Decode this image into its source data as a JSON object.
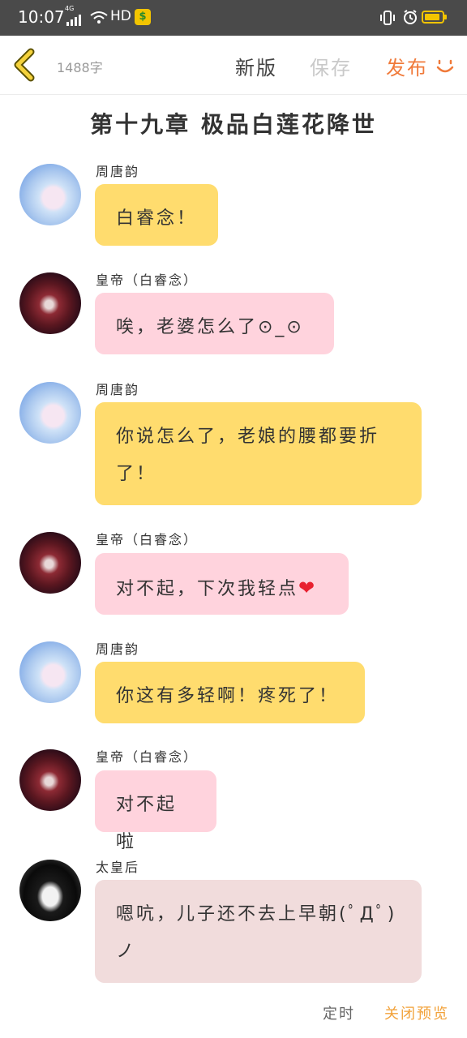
{
  "status_bar": {
    "time": "10:07",
    "network_tag": "4G",
    "hd_label": "HD",
    "app_badge": "$"
  },
  "toolbar": {
    "word_count": "1488字",
    "new_version": "新版",
    "save": "保存",
    "publish": "发布"
  },
  "chapter_title": "第十九章 极品白莲花降世",
  "messages": [
    {
      "speaker": "周唐韵",
      "text": "白睿念！",
      "bubble": "yellow"
    },
    {
      "speaker": "皇帝（白睿念）",
      "text": "唉，老婆怎么了⊙_⊙",
      "bubble": "pink"
    },
    {
      "speaker": "周唐韵",
      "text": "你说怎么了，老娘的腰都要折了！",
      "bubble": "yellow"
    },
    {
      "speaker": "皇帝（白睿念）",
      "text": "对不起，下次我轻点",
      "emoji": "❤",
      "bubble": "pink"
    },
    {
      "speaker": "周唐韵",
      "text": "你这有多轻啊！疼死了！",
      "bubble": "yellow"
    },
    {
      "speaker": "皇帝（白睿念）",
      "text": "对不起啦",
      "bubble": "pink"
    },
    {
      "speaker": "太皇后",
      "text": "嗯吭，儿子还不去上早朝(ﾟДﾟ) ノ",
      "bubble": "grey"
    }
  ],
  "bottom": {
    "timer": "定时",
    "close_preview": "关闭预览"
  },
  "colors": {
    "accent_orange": "#f07a3a",
    "bubble_yellow": "#ffdc6e",
    "bubble_pink": "#ffd3dd",
    "bubble_grey": "#f1dcdc",
    "preview_link": "#f2a23a"
  }
}
